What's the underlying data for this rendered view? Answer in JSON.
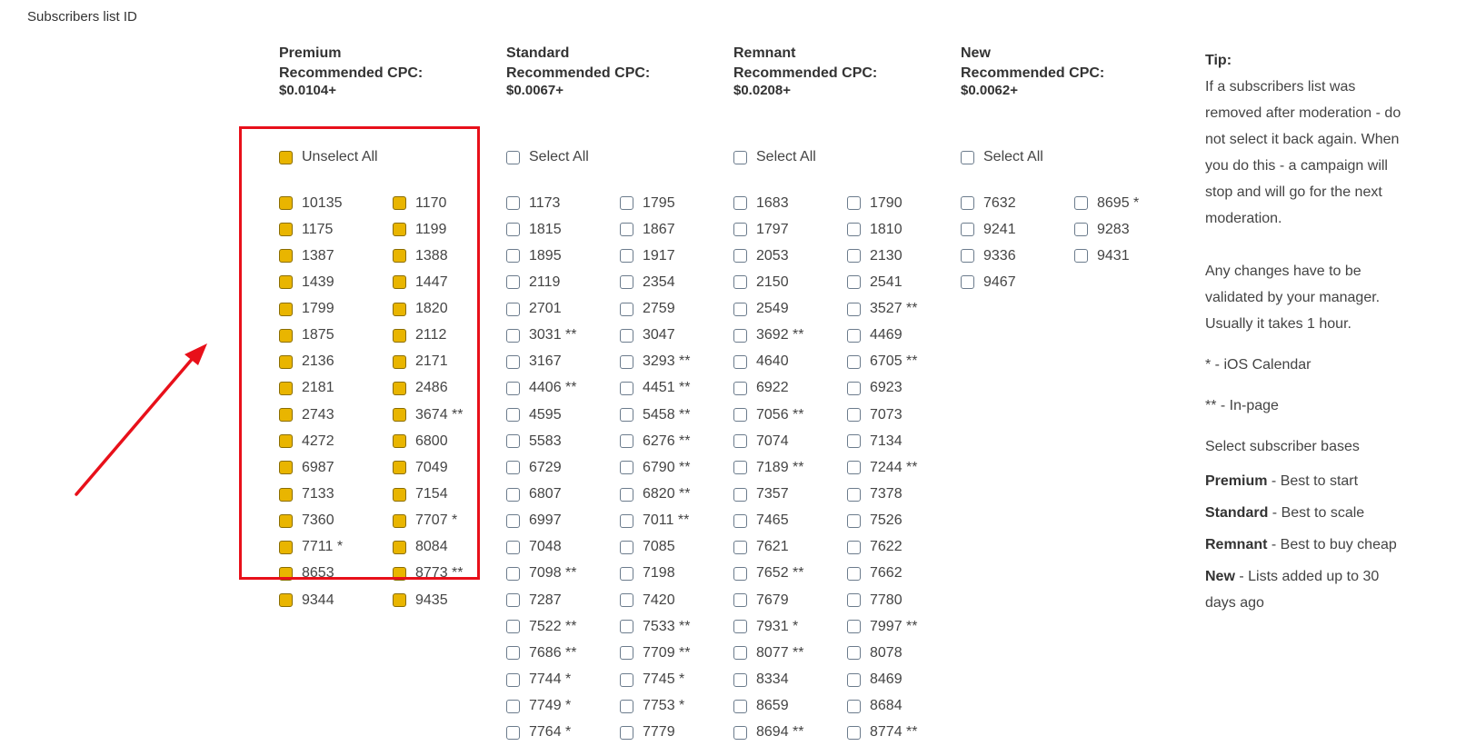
{
  "page_title": "Subscribers list ID",
  "groups": [
    {
      "name": "Premium",
      "recommended_label": "Recommended CPC:",
      "price": "$0.0104+",
      "select_all_label": "Unselect All",
      "select_all_checked": true,
      "items": [
        {
          "label": "10135",
          "checked": true
        },
        {
          "label": "1170",
          "checked": true
        },
        {
          "label": "1175",
          "checked": true
        },
        {
          "label": "1199",
          "checked": true
        },
        {
          "label": "1387",
          "checked": true
        },
        {
          "label": "1388",
          "checked": true
        },
        {
          "label": "1439",
          "checked": true
        },
        {
          "label": "1447",
          "checked": true
        },
        {
          "label": "1799",
          "checked": true
        },
        {
          "label": "1820",
          "checked": true
        },
        {
          "label": "1875",
          "checked": true
        },
        {
          "label": "2112",
          "checked": true
        },
        {
          "label": "2136",
          "checked": true
        },
        {
          "label": "2171",
          "checked": true
        },
        {
          "label": "2181",
          "checked": true
        },
        {
          "label": "2486",
          "checked": true
        },
        {
          "label": "2743",
          "checked": true
        },
        {
          "label": "3674 **",
          "checked": true
        },
        {
          "label": "4272",
          "checked": true
        },
        {
          "label": "6800",
          "checked": true
        },
        {
          "label": "6987",
          "checked": true
        },
        {
          "label": "7049",
          "checked": true
        },
        {
          "label": "7133",
          "checked": true
        },
        {
          "label": "7154",
          "checked": true
        },
        {
          "label": "7360",
          "checked": true
        },
        {
          "label": "7707 *",
          "checked": true
        },
        {
          "label": "7711 *",
          "checked": true
        },
        {
          "label": "8084",
          "checked": true
        },
        {
          "label": "8653",
          "checked": true
        },
        {
          "label": "8773 **",
          "checked": true
        },
        {
          "label": "9344",
          "checked": true
        },
        {
          "label": "9435",
          "checked": true
        }
      ]
    },
    {
      "name": "Standard",
      "recommended_label": "Recommended CPC:",
      "price": "$0.0067+",
      "select_all_label": "Select All",
      "select_all_checked": false,
      "items": [
        {
          "label": "1173",
          "checked": false
        },
        {
          "label": "1795",
          "checked": false
        },
        {
          "label": "1815",
          "checked": false
        },
        {
          "label": "1867",
          "checked": false
        },
        {
          "label": "1895",
          "checked": false
        },
        {
          "label": "1917",
          "checked": false
        },
        {
          "label": "2119",
          "checked": false
        },
        {
          "label": "2354",
          "checked": false
        },
        {
          "label": "2701",
          "checked": false
        },
        {
          "label": "2759",
          "checked": false
        },
        {
          "label": "3031 **",
          "checked": false
        },
        {
          "label": "3047",
          "checked": false
        },
        {
          "label": "3167",
          "checked": false
        },
        {
          "label": "3293 **",
          "checked": false
        },
        {
          "label": "4406 **",
          "checked": false
        },
        {
          "label": "4451 **",
          "checked": false
        },
        {
          "label": "4595",
          "checked": false
        },
        {
          "label": "5458 **",
          "checked": false
        },
        {
          "label": "5583",
          "checked": false
        },
        {
          "label": "6276 **",
          "checked": false
        },
        {
          "label": "6729",
          "checked": false
        },
        {
          "label": "6790 **",
          "checked": false
        },
        {
          "label": "6807",
          "checked": false
        },
        {
          "label": "6820 **",
          "checked": false
        },
        {
          "label": "6997",
          "checked": false
        },
        {
          "label": "7011 **",
          "checked": false
        },
        {
          "label": "7048",
          "checked": false
        },
        {
          "label": "7085",
          "checked": false
        },
        {
          "label": "7098 **",
          "checked": false
        },
        {
          "label": "7198",
          "checked": false
        },
        {
          "label": "7287",
          "checked": false
        },
        {
          "label": "7420",
          "checked": false
        },
        {
          "label": "7522 **",
          "checked": false
        },
        {
          "label": "7533 **",
          "checked": false
        },
        {
          "label": "7686 **",
          "checked": false
        },
        {
          "label": "7709 **",
          "checked": false
        },
        {
          "label": "7744 *",
          "checked": false
        },
        {
          "label": "7745 *",
          "checked": false
        },
        {
          "label": "7749 *",
          "checked": false
        },
        {
          "label": "7753 *",
          "checked": false
        },
        {
          "label": "7764 *",
          "checked": false
        },
        {
          "label": "7779",
          "checked": false
        }
      ]
    },
    {
      "name": "Remnant",
      "recommended_label": "Recommended CPC:",
      "price": "$0.0208+",
      "select_all_label": "Select All",
      "select_all_checked": false,
      "items": [
        {
          "label": "1683",
          "checked": false
        },
        {
          "label": "1790",
          "checked": false
        },
        {
          "label": "1797",
          "checked": false
        },
        {
          "label": "1810",
          "checked": false
        },
        {
          "label": "2053",
          "checked": false
        },
        {
          "label": "2130",
          "checked": false
        },
        {
          "label": "2150",
          "checked": false
        },
        {
          "label": "2541",
          "checked": false
        },
        {
          "label": "2549",
          "checked": false
        },
        {
          "label": "3527 **",
          "checked": false
        },
        {
          "label": "3692 **",
          "checked": false
        },
        {
          "label": "4469",
          "checked": false
        },
        {
          "label": "4640",
          "checked": false
        },
        {
          "label": "6705 **",
          "checked": false
        },
        {
          "label": "6922",
          "checked": false
        },
        {
          "label": "6923",
          "checked": false
        },
        {
          "label": "7056 **",
          "checked": false
        },
        {
          "label": "7073",
          "checked": false
        },
        {
          "label": "7074",
          "checked": false
        },
        {
          "label": "7134",
          "checked": false
        },
        {
          "label": "7189 **",
          "checked": false
        },
        {
          "label": "7244 **",
          "checked": false
        },
        {
          "label": "7357",
          "checked": false
        },
        {
          "label": "7378",
          "checked": false
        },
        {
          "label": "7465",
          "checked": false
        },
        {
          "label": "7526",
          "checked": false
        },
        {
          "label": "7621",
          "checked": false
        },
        {
          "label": "7622",
          "checked": false
        },
        {
          "label": "7652 **",
          "checked": false
        },
        {
          "label": "7662",
          "checked": false
        },
        {
          "label": "7679",
          "checked": false
        },
        {
          "label": "7780",
          "checked": false
        },
        {
          "label": "7931 *",
          "checked": false
        },
        {
          "label": "7997 **",
          "checked": false
        },
        {
          "label": "8077 **",
          "checked": false
        },
        {
          "label": "8078",
          "checked": false
        },
        {
          "label": "8334",
          "checked": false
        },
        {
          "label": "8469",
          "checked": false
        },
        {
          "label": "8659",
          "checked": false
        },
        {
          "label": "8684",
          "checked": false
        },
        {
          "label": "8694 **",
          "checked": false
        },
        {
          "label": "8774 **",
          "checked": false
        }
      ]
    },
    {
      "name": "New",
      "recommended_label": "Recommended CPC:",
      "price": "$0.0062+",
      "select_all_label": "Select All",
      "select_all_checked": false,
      "items": [
        {
          "label": "7632",
          "checked": false
        },
        {
          "label": "8695 *",
          "checked": false
        },
        {
          "label": "9241",
          "checked": false
        },
        {
          "label": "9283",
          "checked": false
        },
        {
          "label": "9336",
          "checked": false
        },
        {
          "label": "9431",
          "checked": false
        },
        {
          "label": "9467",
          "checked": false
        }
      ]
    }
  ],
  "tip": {
    "title": "Tip:",
    "paragraph1": "If a subscribers list was removed after moderation - do not select it back again. When you do this - a campaign will stop and will go for the next moderation.",
    "paragraph2": "Any changes have to be validated by your manager. Usually it takes 1 hour.",
    "legend_single": "* - iOS Calendar",
    "legend_double": "** - In-page",
    "select_bases": "Select subscriber bases",
    "bases": [
      {
        "name": "Premium",
        "desc": " - Best to start"
      },
      {
        "name": "Standard",
        "desc": " - Best to scale"
      },
      {
        "name": "Remnant",
        "desc": " - Best to buy cheap"
      },
      {
        "name": "New",
        "desc": " - Lists added up to 30 days ago"
      }
    ]
  },
  "colors": {
    "checked_fill": "#e9b500",
    "annotation_red": "#e8101a"
  }
}
